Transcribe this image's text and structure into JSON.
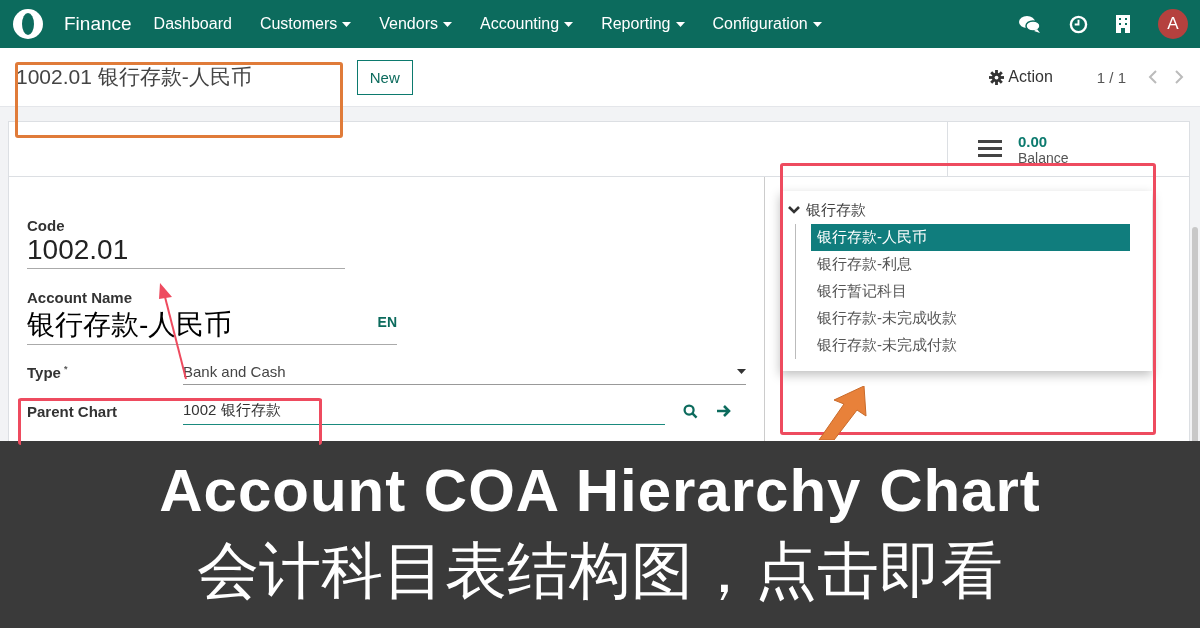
{
  "navbar": {
    "app_name": "Finance",
    "menu": [
      {
        "label": "Dashboard",
        "dropdown": false
      },
      {
        "label": "Customers",
        "dropdown": true
      },
      {
        "label": "Vendors",
        "dropdown": true
      },
      {
        "label": "Accounting",
        "dropdown": true
      },
      {
        "label": "Reporting",
        "dropdown": true
      },
      {
        "label": "Configuration",
        "dropdown": true
      }
    ],
    "avatar": "A"
  },
  "control_panel": {
    "title": "1002.01 银行存款-人民币",
    "new_button": "New",
    "action": "Action",
    "pager": "1 / 1"
  },
  "stat_button": {
    "value": "0.00",
    "label": "Balance"
  },
  "form": {
    "fields": [
      {
        "kind": "big",
        "label": "Code",
        "value": "1002.01"
      },
      {
        "kind": "translatable",
        "label": "Account Name",
        "value": "银行存款-人民币",
        "lang": "EN"
      },
      {
        "kind": "select",
        "label": "Type",
        "required_mark": "*",
        "value": "Bank and Cash"
      },
      {
        "kind": "many2one",
        "label": "Parent Chart",
        "value": "1002 银行存款"
      }
    ]
  },
  "tree": {
    "label": "银行存款",
    "expanded": true,
    "children": [
      {
        "label": "银行存款-人民币",
        "selected": true
      },
      {
        "label": "银行存款-利息",
        "selected": false
      },
      {
        "label": "银行暂记科目",
        "selected": false
      },
      {
        "label": "银行存款-未完成收款",
        "selected": false
      },
      {
        "label": "银行存款-未完成付款",
        "selected": false
      }
    ]
  },
  "banner": {
    "title": "Account COA Hierarchy Chart",
    "subtitle": "会计科目表结构图，点击即看"
  }
}
